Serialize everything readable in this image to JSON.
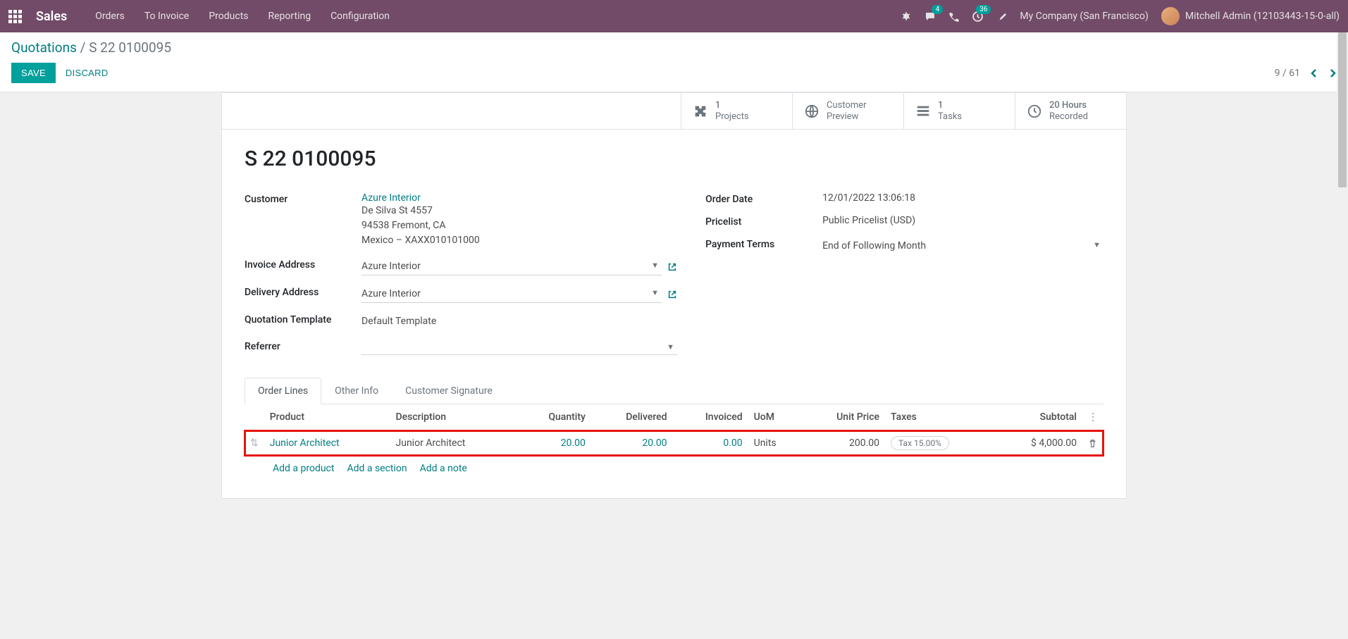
{
  "navbar": {
    "app_name": "Sales",
    "menu": [
      "Orders",
      "To Invoice",
      "Products",
      "Reporting",
      "Configuration"
    ],
    "chat_badge": "4",
    "activity_badge": "36",
    "company": "My Company (San Francisco)",
    "user": "Mitchell Admin (12103443-15-0-all)"
  },
  "breadcrumb": {
    "root": "Quotations",
    "current": "S 22 0100095"
  },
  "buttons": {
    "save": "SAVE",
    "discard": "DISCARD"
  },
  "pager": {
    "text": "9 / 61"
  },
  "stat_buttons": [
    {
      "num": "1",
      "label": "Projects",
      "icon": "puzzle"
    },
    {
      "num": "",
      "label": "Customer\nPreview",
      "icon": "globe"
    },
    {
      "num": "1",
      "label": "Tasks",
      "icon": "tasks"
    },
    {
      "num": "20 Hours",
      "label": "Recorded",
      "icon": "clock"
    }
  ],
  "record": {
    "title": "S 22 0100095",
    "customer_label": "Customer",
    "customer_name": "Azure Interior",
    "address": {
      "street": "De Silva St 4557",
      "city": "94538 Fremont, CA",
      "country": "Mexico – XAXX010101000"
    },
    "invoice_address_label": "Invoice Address",
    "invoice_address": "Azure Interior",
    "delivery_address_label": "Delivery Address",
    "delivery_address": "Azure Interior",
    "quotation_template_label": "Quotation Template",
    "quotation_template": "Default Template",
    "referrer_label": "Referrer",
    "order_date_label": "Order Date",
    "order_date": "12/01/2022 13:06:18",
    "pricelist_label": "Pricelist",
    "pricelist": "Public Pricelist (USD)",
    "payment_terms_label": "Payment Terms",
    "payment_terms": "End of Following Month"
  },
  "tabs": {
    "order_lines": "Order Lines",
    "other_info": "Other Info",
    "customer_signature": "Customer Signature"
  },
  "order_table": {
    "headers": {
      "product": "Product",
      "description": "Description",
      "quantity": "Quantity",
      "delivered": "Delivered",
      "invoiced": "Invoiced",
      "uom": "UoM",
      "unit_price": "Unit Price",
      "taxes": "Taxes",
      "subtotal": "Subtotal"
    },
    "rows": [
      {
        "product": "Junior Architect",
        "description": "Junior Architect",
        "quantity": "20.00",
        "delivered": "20.00",
        "invoiced": "0.00",
        "uom": "Units",
        "unit_price": "200.00",
        "tax": "Tax 15.00%",
        "subtotal": "$ 4,000.00"
      }
    ],
    "add_product": "Add a product",
    "add_section": "Add a section",
    "add_note": "Add a note"
  }
}
